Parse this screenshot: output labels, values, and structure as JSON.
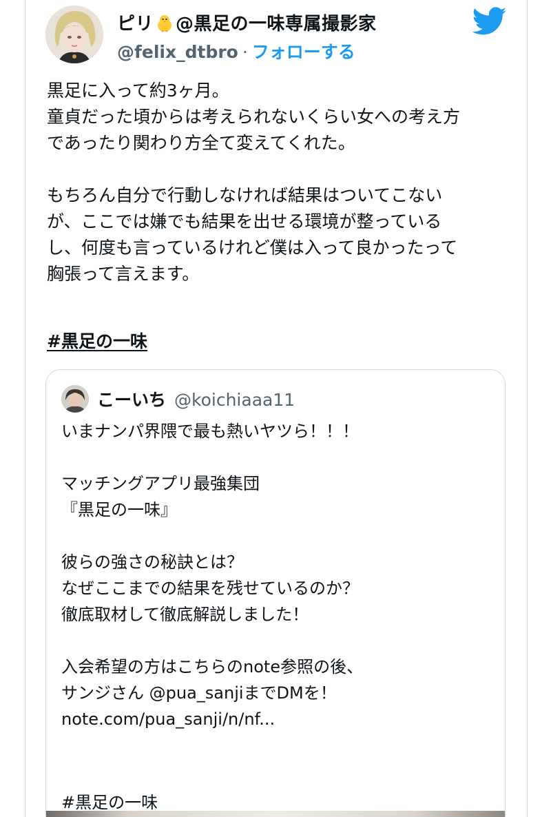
{
  "author": {
    "name_prefix": "ピリ",
    "name_suffix": "@黒足の一味専属撮影家",
    "handle": "@felix_dtbro",
    "separator": "·",
    "follow": "フォローする"
  },
  "tweet": {
    "text": "黒足に入って約3ヶ月。\n童貞だった頃からは考えられないくらい女への考え方\nであったり関わり方全て変えてくれた。\n\nもちろん自分で行動しなければ結果はついてこない\nが、ここでは嫌でも結果を出せる環境が整っている\nし、何度も言っているけれど僕は入って良かったって\n胸張って言えます。",
    "hashtag": "#黒足の一味"
  },
  "quoted_tweet": {
    "name": "こーいち",
    "handle": "@koichiaaa11",
    "text": "いまナンパ界隈で最も熱いヤツら！！！\n\nマッチングアプリ最強集団\n『黒足の一味』\n\n彼らの強さの秘訣とは？\nなぜここまでの結果を残せているのか？\n徹底取材して徹底解説しました！\n\n入会希望の方はこちらのnote参照の後、\nサンジさん @pua_sanjiまでDMを！\nnote.com/pua_sanji/n/nf...",
    "hashtag": "#黒足の一味"
  },
  "colors": {
    "accent": "#1d9bf0",
    "text": "#0f1419",
    "secondary": "#536471",
    "border": "#cfd9de"
  },
  "icons": [
    "chick-emoji-icon",
    "twitter-bird-icon"
  ]
}
